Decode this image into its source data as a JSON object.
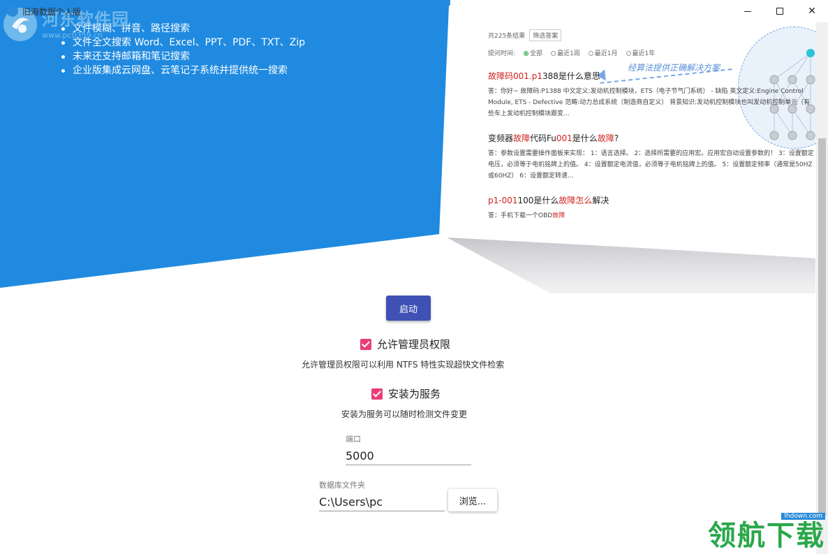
{
  "window": {
    "title": "旧海数据个人版",
    "minimize_label": "—",
    "maximize_label": "☐",
    "close_label": "✕"
  },
  "watermark_top": {
    "text": "河东软件园",
    "url": "www.pc0359.cn"
  },
  "hero": {
    "features": [
      "文件模糊、拼音、路径搜索",
      "文件全文搜索 Word、Excel、PPT、PDF、TXT、Zip",
      "未来还支持邮箱和笔记搜索",
      "企业版集成云网盘、云笔记子系统并提供统一搜索"
    ],
    "colors": {
      "hero_blue": "#1f8ae0",
      "accent": "#3f51b5",
      "checkbox": "#e83e7a"
    },
    "screenshot": {
      "results_count": "共225条结果",
      "filter_label": "筛选答案",
      "time_label": "提问时间:",
      "time_options": [
        "全部",
        "最近1周",
        "最近1月",
        "最近1年"
      ],
      "callout": "经算法提供正确解决方案",
      "q1": {
        "prefix": "故障码",
        "code": "001.p1",
        "rest": "388是什么意思"
      },
      "a1": "答：你好~ 故障码:P1388 中文定义:发动机控制模块，ETS（电子节气门系统） - 缺陷 英文定义:Engine Control Module, ETS - Defective 范畴:动力总成系统（制造商自定义） 背景知识:发动机控制模块也叫发动机控制单元（有些车上发动机控制模块跟变...",
      "q2": {
        "prefix": "变频器",
        "red1": "故障",
        "mid": "代码Fu",
        "red2": "001",
        "mid2": "是什么",
        "red3": "故障",
        "end": "?"
      },
      "a2": "答：参数设置需要操作面板来实现： 1：语言选择。 2：选择所需要的应用宏。应用宏自动设置参数的！ 3：设置额定电压，必须等于电机铭牌上的值。 4：设置额定电流值，必须等于电机铭牌上的值。 5：设置额定频率（通常是50HZ或60HZ） 6：设置额定转速...",
      "q3": {
        "red1": "p1-001",
        "mid": "100是什么",
        "red2": "故障怎么",
        "end": "解决"
      },
      "a3": {
        "prefix": "答：手机下载一个OBD",
        "red": "故障"
      }
    }
  },
  "controls": {
    "start_label": "启动",
    "admin_checkbox_label": "允许管理员权限",
    "admin_checked": true,
    "admin_desc": "允许管理员权限可以利用 NTFS 特性实现超快文件检索",
    "service_checkbox_label": "安装为服务",
    "service_checked": true,
    "service_desc": "安装为服务可以随时检测文件变更",
    "port_label": "端口",
    "port_value": "5000",
    "db_label": "数据库文件夹",
    "db_value": "C:\\Users\\pc",
    "browse_label": "浏览..."
  },
  "watermark_bottom": {
    "url": "lhdown.com",
    "text": "领航下载"
  }
}
